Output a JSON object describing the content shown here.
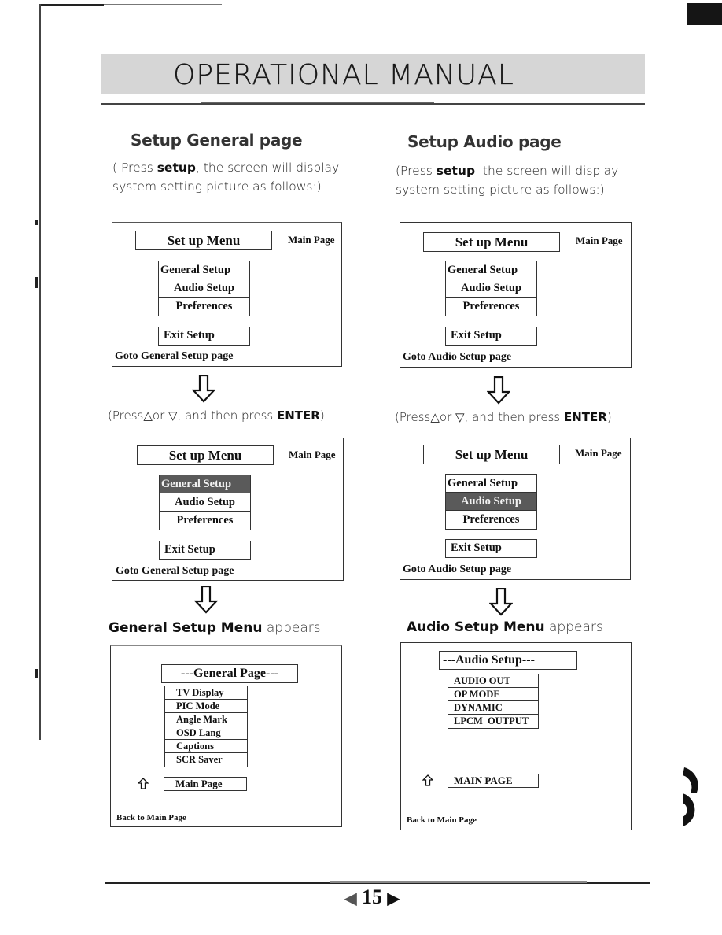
{
  "header": {
    "title": "OPERATIONAL MANUAL"
  },
  "left": {
    "section_title": "Setup General  page",
    "desc_prefix": "( Press ",
    "desc_key": "setup",
    "desc_suffix": ", the screen will display",
    "desc_line2": "system setting picture as follows:)",
    "screen1": {
      "menu_title": "Set up Menu",
      "main_page": "Main Page",
      "items": [
        "General Setup",
        "Audio Setup",
        "Preferences"
      ],
      "exit": "Exit Setup",
      "goto": "Goto General Setup page"
    },
    "press_prefix": "(Press",
    "press_up": "△",
    "press_or": "or ",
    "press_down": "▽",
    "press_mid": ", and then press ",
    "press_key": "ENTER",
    "press_close": ")",
    "screen2": {
      "menu_title": "Set up Menu",
      "main_page": "Main Page",
      "items": [
        "General Setup",
        "Audio Setup",
        "Preferences"
      ],
      "selected_index": 0,
      "exit": "Exit Setup",
      "goto": "Goto General Setup page"
    },
    "appears_bold": "General  Setup  Menu",
    "appears_word": " appears",
    "screen3": {
      "title": "---General Page---",
      "items": [
        "TV Display",
        "PIC Mode",
        "Angle Mark",
        "OSD Lang",
        "Captions",
        "SCR Saver"
      ],
      "main_page": "Main Page",
      "back": "Back to Main Page"
    }
  },
  "right": {
    "section_title": "Setup Audio page",
    "desc_prefix": "(Press ",
    "desc_key": "setup",
    "desc_suffix": ", the screen will display",
    "desc_line2": "system setting picture as follows:)",
    "screen1": {
      "menu_title": "Set up Menu",
      "main_page": "Main Page",
      "items": [
        "General Setup",
        "Audio Setup",
        "Preferences"
      ],
      "exit": "Exit Setup",
      "goto": "Goto Audio Setup page"
    },
    "press_prefix": "(Press",
    "press_up": "△",
    "press_or": "or ",
    "press_down": "▽",
    "press_mid": ", and then press ",
    "press_key": "ENTER",
    "press_close": ")",
    "screen2": {
      "menu_title": "Set up Menu",
      "main_page": "Main Page",
      "items": [
        "General Setup",
        "Audio Setup",
        "Preferences"
      ],
      "selected_index": 1,
      "exit": "Exit Setup",
      "goto": "Goto Audio Setup page"
    },
    "appears_bold": "Audio Setup Menu",
    "appears_word": " appears",
    "screen3": {
      "title": "---Audio  Setup---",
      "items": [
        "AUDIO OUT",
        "OP MODE",
        "DYNAMIC",
        "LPCM  OUTPUT"
      ],
      "main_page": "MAIN PAGE",
      "back": "Back to Main Page"
    }
  },
  "icons": {
    "down_arrow": "hollow-down-arrow",
    "up_arrow": "hollow-up-arrow",
    "prev": "◀",
    "next": "▶"
  },
  "footer": {
    "page_number": "15"
  }
}
